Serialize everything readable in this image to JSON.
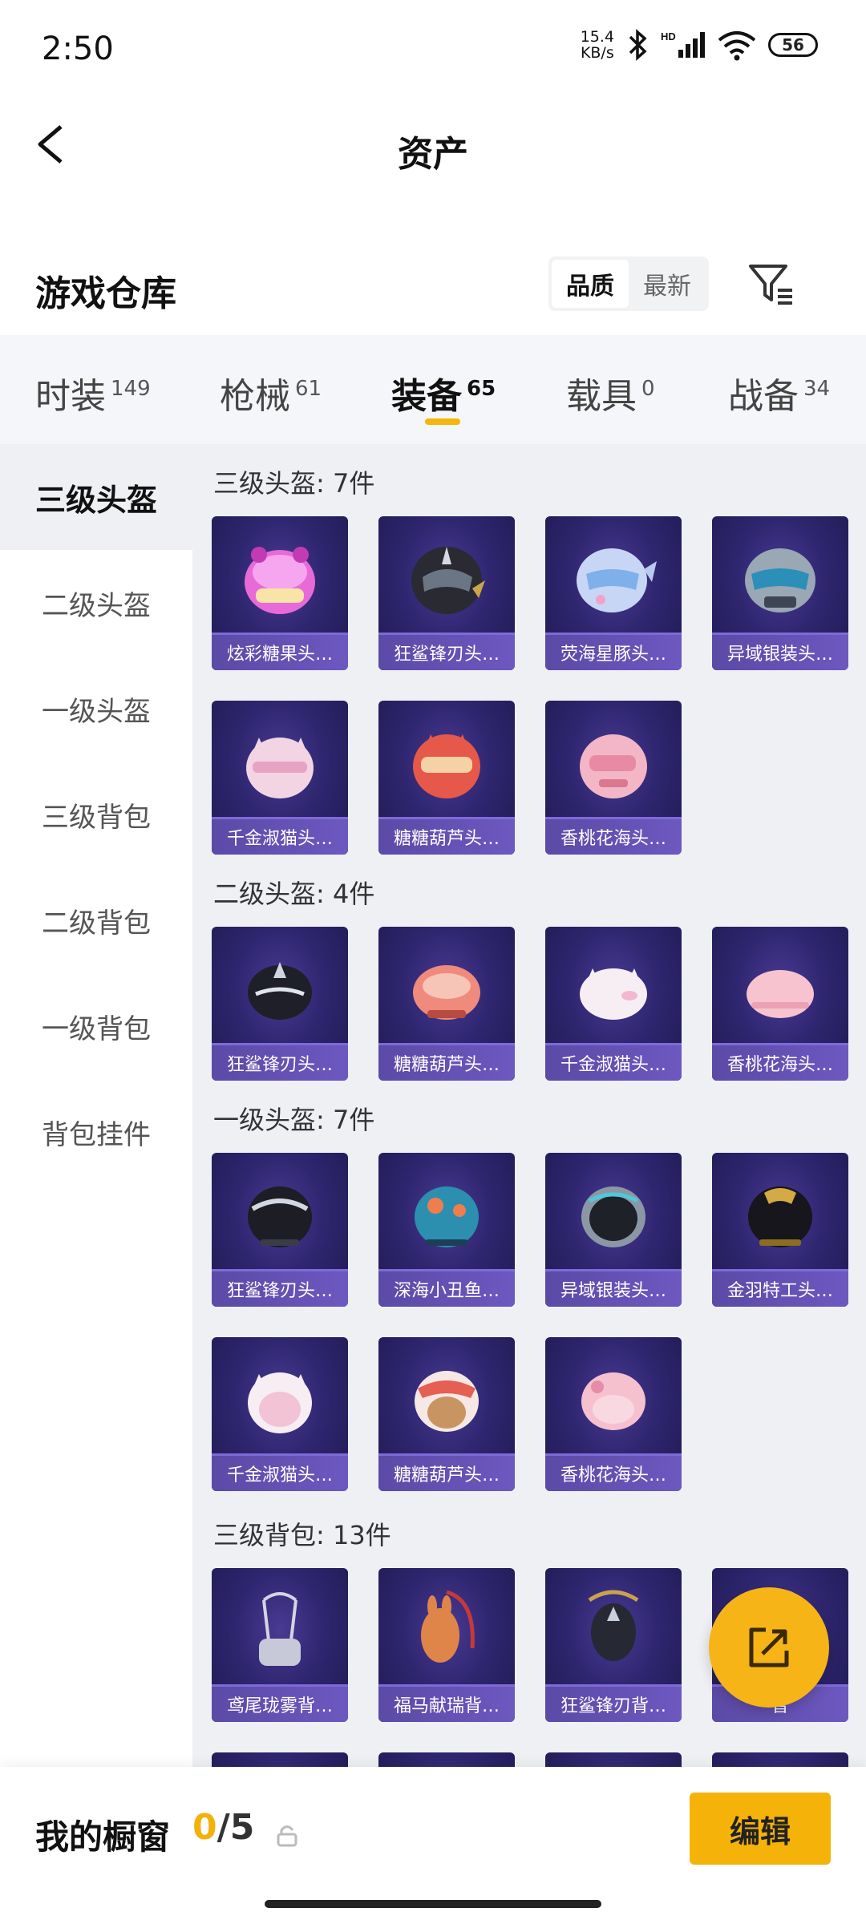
{
  "status_bar": {
    "time": "2:50",
    "speed": "15.4",
    "speed_unit": "KB/s",
    "battery": "56",
    "network_label": "HD"
  },
  "header": {
    "title": "资产"
  },
  "warehouse": {
    "title": "游戏仓库",
    "sort_options": [
      "品质",
      "最新"
    ],
    "active_sort": "品质"
  },
  "tabs": [
    {
      "label": "时装",
      "count": "149"
    },
    {
      "label": "枪械",
      "count": "61"
    },
    {
      "label": "装备",
      "count": "65"
    },
    {
      "label": "载具",
      "count": "0"
    },
    {
      "label": "战备",
      "count": "34"
    }
  ],
  "sidebar": {
    "items": [
      "三级头盔",
      "二级头盔",
      "一级头盔",
      "三级背包",
      "二级背包",
      "一级背包",
      "背包挂件"
    ],
    "active": "三级头盔"
  },
  "sections": [
    {
      "title": "三级头盔: 7件",
      "items": [
        "炫彩糖果头…",
        "狂鲨锋刃头…",
        "荧海星豚头…",
        "异域银装头…",
        "千金淑猫头…",
        "糖糖葫芦头…",
        "香桃花海头…"
      ]
    },
    {
      "title": "二级头盔: 4件",
      "items": [
        "狂鲨锋刃头…",
        "糖糖葫芦头…",
        "千金淑猫头…",
        "香桃花海头…"
      ]
    },
    {
      "title": "一级头盔: 7件",
      "items": [
        "狂鲨锋刃头…",
        "深海小丑鱼…",
        "异域银装头…",
        "金羽特工头…",
        "千金淑猫头…",
        "糖糖葫芦头…",
        "香桃花海头…"
      ]
    },
    {
      "title": "三级背包: 13件",
      "items": [
        "鸢尾珑雾背…",
        "福马献瑞背…",
        "狂鲨锋刃背…",
        "智"
      ]
    }
  ],
  "bottom": {
    "label": "我的橱窗",
    "count_used": "0",
    "count_total": "/5",
    "edit_label": "编辑"
  }
}
